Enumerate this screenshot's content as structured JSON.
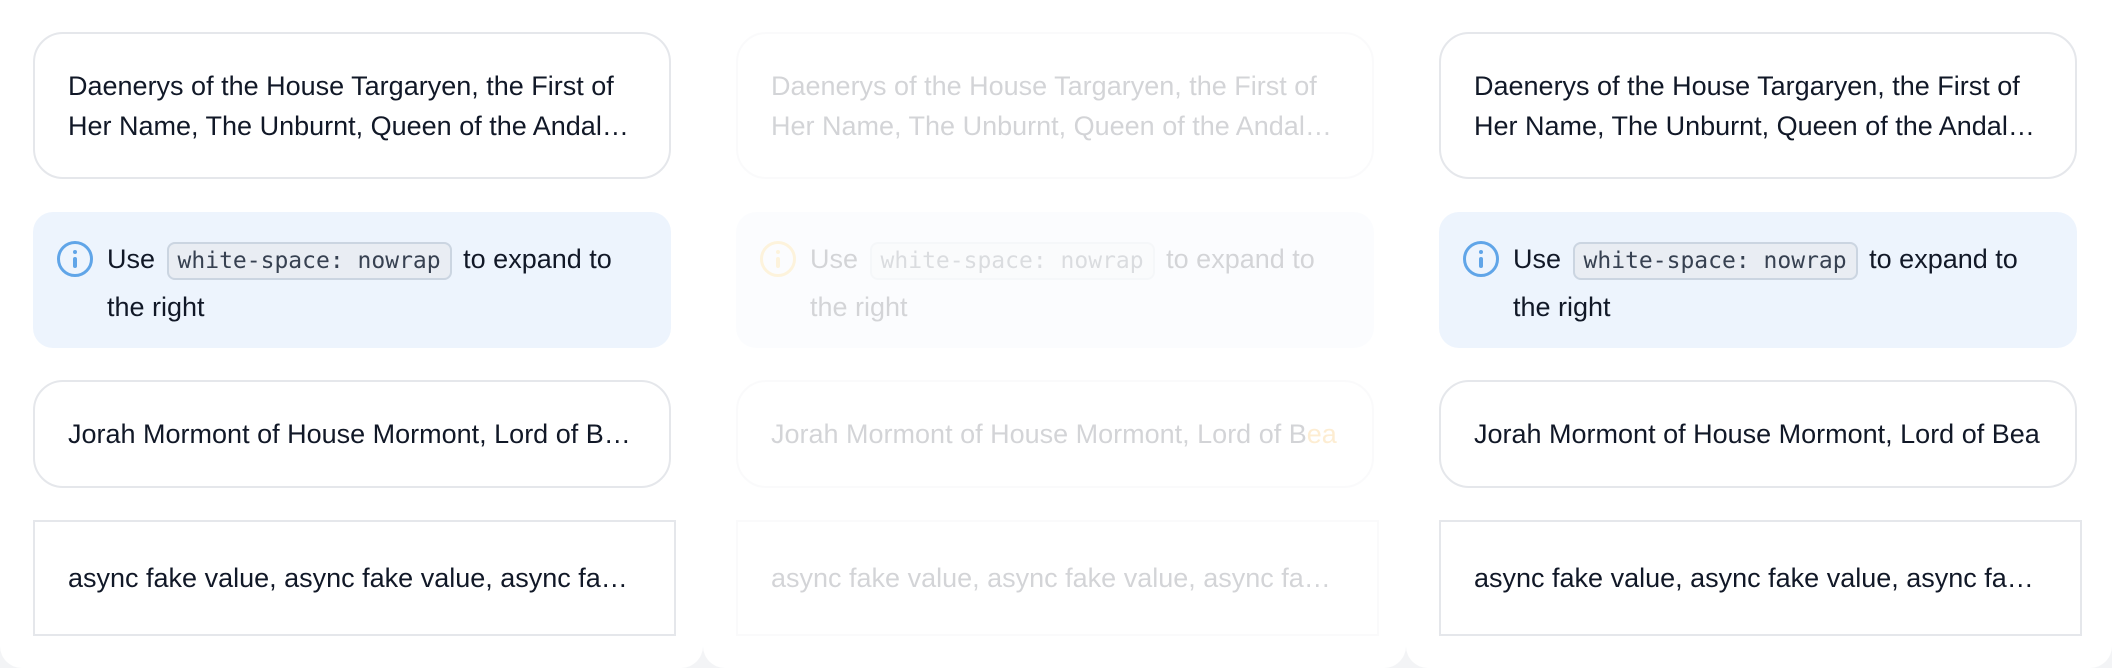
{
  "panels": [
    {
      "title_card": "Daenerys of the House Targaryen, the First of Her Name, The Unburnt, Queen of the Andals, the Rhoynar and the First Men",
      "info": {
        "prefix": "Use",
        "code": "white-space: nowrap",
        "suffix": "to expand to the right"
      },
      "name_card": "Jorah Mormont of House Mormont, Lord of Bear Island",
      "async_card": "async fake value, async fake value, async fake value"
    },
    {
      "title_card": "Daenerys of the House Targaryen, the First of Her Name, The Unburnt, Queen of the Andals, the Rhoynar and the First Men",
      "info": {
        "prefix": "Use",
        "code": "white-space: nowrap",
        "suffix": "to expand to the right"
      },
      "name_card_visible": "Jorah Mormont of House Mormont, Lord of B",
      "name_card_overflow": "ea",
      "async_card": "async fake value, async fake value, async fake value"
    },
    {
      "title_card": "Daenerys of the House Targaryen, the First of Her Name, The Unburnt, Queen of the Andals, the Rhoynar and the First Men",
      "info": {
        "prefix": "Use",
        "code": "white-space: nowrap",
        "suffix": "to expand to the right"
      },
      "name_card": "Jorah Mormont of House Mormont, Lord of Bear Island",
      "async_card": "async fake value, async fake value, async fake value"
    }
  ],
  "colors": {
    "info_bg": "#edf4fd",
    "info_icon": "#60a5e8",
    "warning_icon": "#f6c343",
    "overflow_text": "#f59e0b"
  }
}
